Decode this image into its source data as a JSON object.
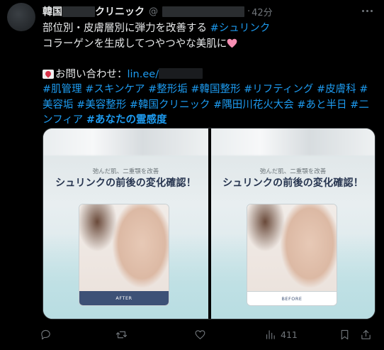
{
  "post": {
    "author_name_prefix": "韓国",
    "author_name_suffix": "クリニック",
    "handle_prefix": "@",
    "separator": "·",
    "time": "42分",
    "lines": {
      "l1_text": "部位別・皮膚層別に弾力を改善する",
      "l1_tag": "#シュリンク",
      "l2_text": "コラーゲンを生成してつやつやな美肌に",
      "l4_text": "お問い合わせ：",
      "l4_link": "lin.ee/",
      "l5_tags": [
        "#肌管理",
        "#スキンケア",
        "#整形垢",
        "#韓国整形",
        "#リフティング",
        "#皮膚科",
        "#"
      ],
      "l6_tags": [
        "美容垢",
        "#美容整形",
        "#韓国クリニック",
        "#隅田川花火大会",
        "#あと半日",
        "#二"
      ],
      "l7_tag": "ンフィア",
      "l7_tag_bold": "#あなたの霊感度"
    }
  },
  "media": {
    "panels": [
      {
        "subtitle": "弛んだ肌、二重顎を改善",
        "title": "シュリンクの前後の変化確認！",
        "caption": "AFTER"
      },
      {
        "subtitle": "弛んだ肌、二重顎を改善",
        "title": "シュリンクの前後の変化確認！",
        "caption": "BEFORE"
      }
    ]
  },
  "actions": {
    "views_count": "411",
    "icons": [
      "reply-icon",
      "repost-icon",
      "like-icon",
      "views-icon",
      "bookmark-icon",
      "share-icon"
    ]
  },
  "colors": {
    "accent": "#1d9bf0",
    "muted": "#71767b",
    "text": "#e7e9ea",
    "background": "#000000"
  }
}
